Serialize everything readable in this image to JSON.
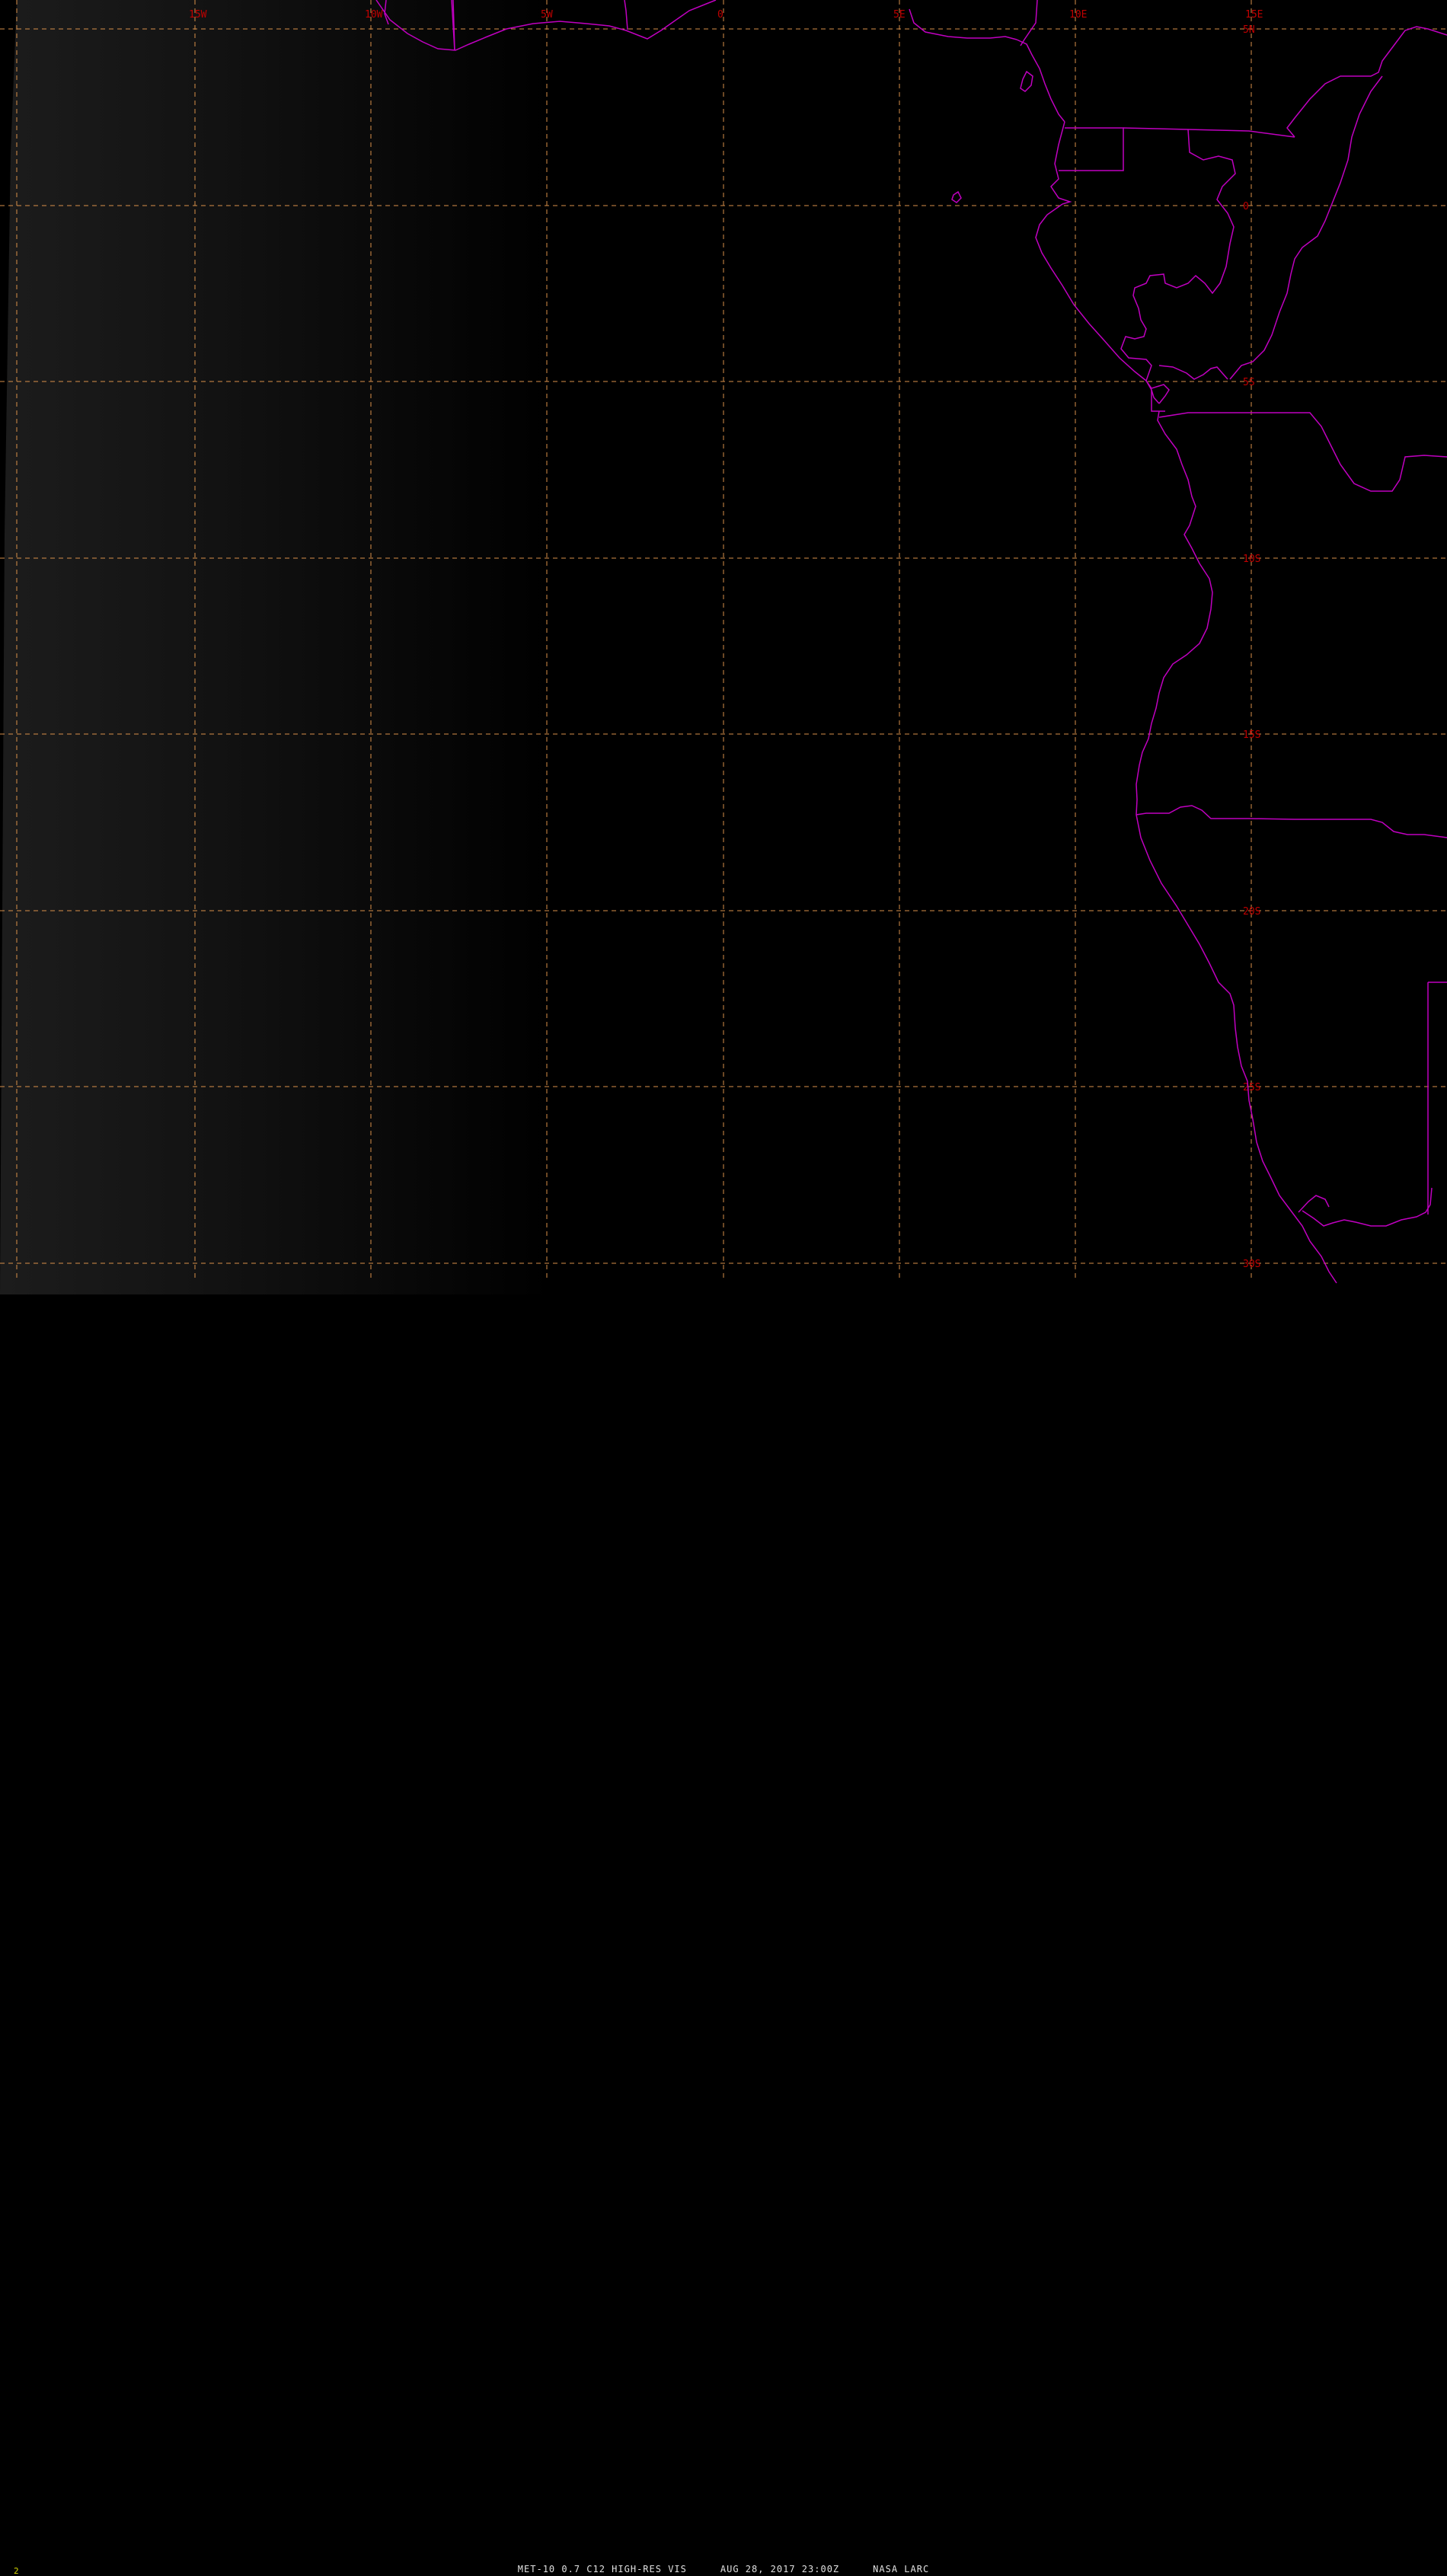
{
  "map": {
    "colors": {
      "background": "#000000",
      "grid": "#d9904a",
      "borders": "#c000c0",
      "tick_labels": "#c00000",
      "caption": "#e0e0e0",
      "frame_number": "#d6d600"
    },
    "longitude_labels": [
      "15W",
      "10W",
      "5W",
      "0",
      "5E",
      "10E",
      "15E"
    ],
    "latitude_labels": [
      "5N",
      "0",
      "5S",
      "10S",
      "15S",
      "20S",
      "25S",
      "30S"
    ]
  },
  "footer": {
    "frame_number": "2",
    "product": "MET-10 0.7 C12 HIGH-RES VIS",
    "datetime": "AUG 28, 2017 23:00Z",
    "credit": "NASA LARC"
  }
}
